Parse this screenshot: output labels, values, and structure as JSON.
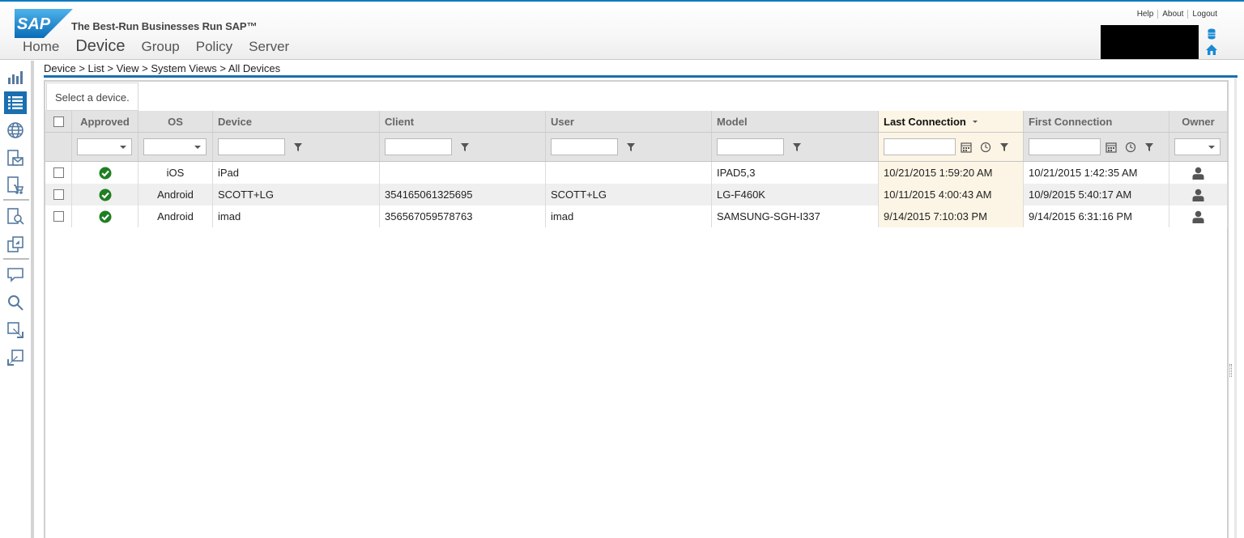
{
  "header": {
    "brand": "SAP",
    "tagline": "The Best-Run Businesses Run SAP™",
    "nav": [
      "Home",
      "Device",
      "Group",
      "Policy",
      "Server"
    ],
    "active_nav": "Device",
    "links": [
      "Help",
      "About",
      "Logout"
    ],
    "brand_color": "#1a6fb0"
  },
  "breadcrumb": "Device > List > View > System Views > All Devices",
  "panel": {
    "hint": "Select a device."
  },
  "sidebar": {
    "icons": [
      "chart-icon",
      "list-icon",
      "globe-icon",
      "mail-device-icon",
      "checkout-icon",
      "search-doc-icon",
      "copy-icon",
      "message-icon",
      "search-icon",
      "import-icon",
      "export-icon"
    ],
    "active": "list-icon"
  },
  "grid": {
    "columns": [
      "Approved",
      "OS",
      "Device",
      "Client",
      "User",
      "Model",
      "Last Connection",
      "First Connection",
      "Owner"
    ],
    "sorted_column": "Last Connection",
    "sort_direction": "descending",
    "rows": [
      {
        "approved": "check-icon",
        "os": "iOS",
        "device": "iPad",
        "client": "",
        "user": "",
        "model": "IPAD5,3",
        "last": "10/21/2015 1:59:20 AM",
        "first": "10/21/2015 1:42:35 AM",
        "owner": "person-icon"
      },
      {
        "approved": "check-icon",
        "os": "Android",
        "device": "SCOTT+LG",
        "client": "354165061325695",
        "user": "SCOTT+LG",
        "model": "LG-F460K",
        "last": "10/11/2015 4:00:43 AM",
        "first": "10/9/2015 5:40:17 AM",
        "owner": "person-icon"
      },
      {
        "approved": "check-icon",
        "os": "Android",
        "device": "imad",
        "client": "356567059578763",
        "user": "imad",
        "model": "SAMSUNG-SGH-I337",
        "last": "9/14/2015 7:10:03 PM",
        "first": "9/14/2015 6:31:16 PM",
        "owner": "person-icon"
      }
    ]
  },
  "colors": {
    "accent": "#1a6fb0",
    "approved": "#1e7e22",
    "sorted_bg": "#fcf5e5"
  }
}
